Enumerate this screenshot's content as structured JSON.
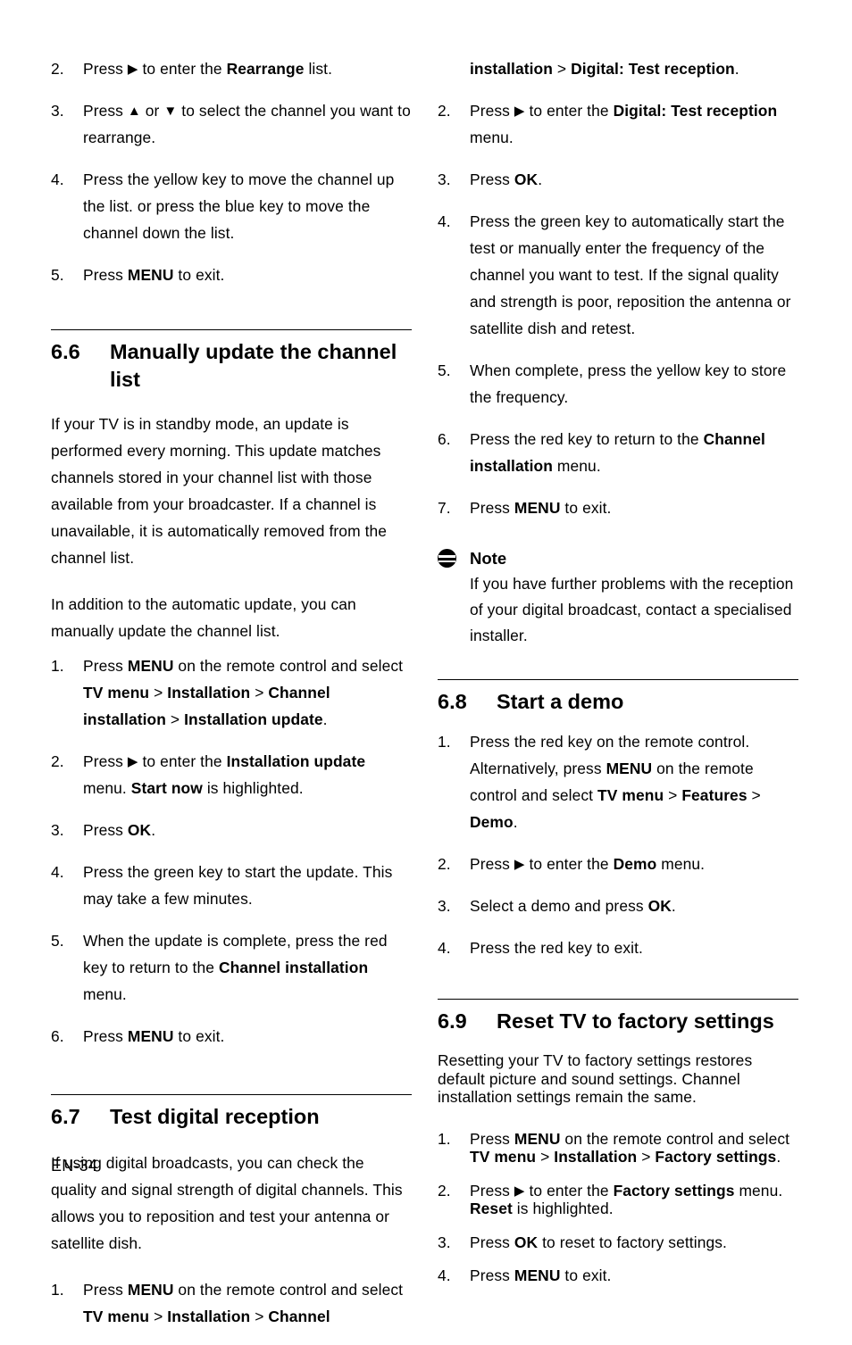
{
  "page": {
    "footer": "EN-34"
  },
  "glyphs": {
    "right": "▶",
    "up": "▲",
    "down": "▼"
  },
  "left_column": {
    "top_items": [
      {
        "num": "2.",
        "text_html": "Press <span class=\"tri\">▶</span> to enter the <b>Rearrange</b> list."
      },
      {
        "num": "3.",
        "text_html": "Press <span class=\"tri\">▲</span> or <span class=\"tri\">▼</span> to select the channel you want to rearrange."
      },
      {
        "num": "4.",
        "text_html": "Press the yellow key to move the channel up the list. or press the blue key to move the channel down the list."
      },
      {
        "num": "5.",
        "text_html": "Press <b>MENU</b> to exit."
      }
    ],
    "section_6_6": {
      "number": "6.6",
      "title": "Manually update the channel list",
      "paragraphs": [
        "If your TV is in standby mode, an update is performed every morning. This update matches channels stored in your channel list with those available from your broadcaster. If a channel is unavailable, it is automatically removed from the channel list.",
        "In addition to the automatic update, you can manually update the channel list."
      ],
      "items": [
        {
          "num": "1.",
          "text_html": "Press <b>MENU</b> on the remote control and select <b>TV menu</b> > <b>Installation</b> > <b>Channel installation</b> > <b>Installation update</b>."
        },
        {
          "num": "2.",
          "text_html": "Press <span class=\"tri\">▶</span> to enter the <b>Installation update</b> menu. <b>Start now</b> is highlighted."
        },
        {
          "num": "3.",
          "text_html": "Press <b>OK</b>."
        },
        {
          "num": "4.",
          "text_html": "Press the green key to start the update. This may take a few minutes."
        },
        {
          "num": "5.",
          "text_html": "When the update is complete, press the red key to return to the <b>Channel installation</b> menu."
        },
        {
          "num": "6.",
          "text_html": "Press <b>MENU</b> to exit."
        }
      ]
    },
    "section_6_7": {
      "number": "6.7",
      "title": "Test digital reception",
      "paragraphs": [
        "If using digital broadcasts, you can check the quality and signal strength of digital channels. This allows you to reposition and test your antenna or satellite dish."
      ],
      "items": [
        {
          "num": "1.",
          "text_html": "Press <b>MENU</b> on the remote control and select <b>TV menu</b> > <b>Installation</b> > <b>Channel</b>"
        }
      ]
    }
  },
  "right_column": {
    "continued_item": {
      "text_html": "<b>installation</b> > <b>Digital: Test reception</b>."
    },
    "items_6_7": [
      {
        "num": "2.",
        "text_html": "Press <span class=\"tri\">▶</span> to enter the <b>Digital: Test reception</b> menu."
      },
      {
        "num": "3.",
        "text_html": "Press <b>OK</b>."
      },
      {
        "num": "4.",
        "text_html": "Press the green key to automatically start the test or manually enter the frequency of the channel you want to test. If the signal quality and strength is poor, reposition the antenna or satellite dish and retest."
      },
      {
        "num": "5.",
        "text_html": "When complete, press the yellow key to store the frequency."
      },
      {
        "num": "6.",
        "text_html": "Press the red key to return to the <b>Channel installation</b> menu."
      },
      {
        "num": "7.",
        "text_html": "Press <b>MENU</b> to exit."
      }
    ],
    "note": {
      "icon": "note-icon",
      "title": "Note",
      "body": "If you have further problems with the reception of your digital broadcast, contact a specialised installer."
    },
    "section_6_8": {
      "number": "6.8",
      "title": "Start a demo",
      "items": [
        {
          "num": "1.",
          "text_html": "Press the red key on the remote control. Alternatively, press <b>MENU</b> on the remote control and select <b>TV menu</b> > <b>Features</b> > <b>Demo</b>."
        },
        {
          "num": "2.",
          "text_html": "Press <span class=\"tri\">▶</span> to enter the <b>Demo</b> menu."
        },
        {
          "num": "3.",
          "text_html": "Select a demo and press <b>OK</b>."
        },
        {
          "num": "4.",
          "text_html": "Press the red key to exit."
        }
      ]
    },
    "section_6_9": {
      "number": "6.9",
      "title": "Reset TV to factory settings",
      "paragraphs": [
        "Resetting your TV to factory settings restores default picture and sound settings. Channel installation settings remain the same."
      ],
      "items": [
        {
          "num": "1.",
          "text_html": "Press <b>MENU</b> on the remote control and select <b>TV menu</b> > <b>Installation</b> > <b>Factory settings</b>."
        },
        {
          "num": "2.",
          "text_html": "Press <span class=\"tri\">▶</span> to enter the <b>Factory settings</b> menu. <b>Reset</b> is highlighted."
        },
        {
          "num": "3.",
          "text_html": "Press <b>OK</b> to reset to factory settings."
        },
        {
          "num": "4.",
          "text_html": "Press <b>MENU</b> to exit."
        }
      ]
    }
  }
}
